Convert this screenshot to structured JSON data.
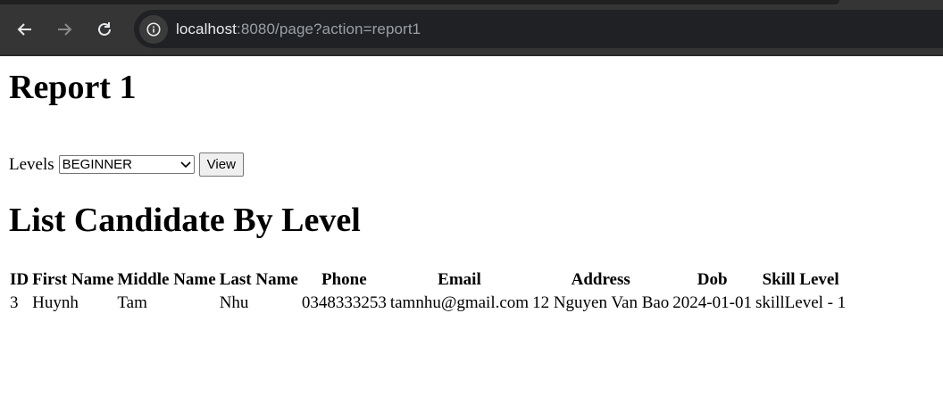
{
  "browser": {
    "url_host": "localhost",
    "url_rest": ":8080/page?action=report1"
  },
  "page": {
    "title": "Report 1",
    "levels_label": "Levels",
    "level_selected": "BEGINNER",
    "view_label": "View",
    "list_title": "List Candidate By Level"
  },
  "table": {
    "headers": [
      "ID",
      "First Name",
      "Middle Name",
      "Last Name",
      "Phone",
      "Email",
      "Address",
      "Dob",
      "Skill Level"
    ],
    "rows": [
      [
        "3",
        "Huynh",
        "Tam",
        "Nhu",
        "0348333253",
        "tamnhu@gmail.com",
        "12 Nguyen Van Bao",
        "2024-01-01",
        "skillLevel - 1"
      ]
    ]
  }
}
